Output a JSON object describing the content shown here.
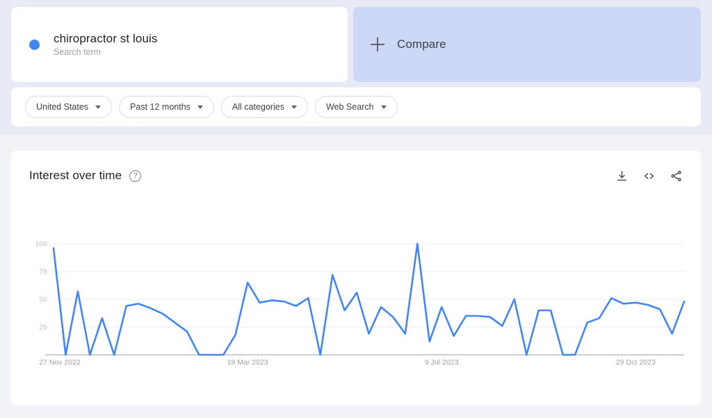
{
  "query": {
    "term": "chiropractor st louis",
    "type_label": "Search term",
    "dot_color": "#4285f4"
  },
  "compare": {
    "label": "Compare",
    "icon": "plus-icon",
    "background": "#ccd8f5"
  },
  "filters": [
    {
      "name": "location",
      "label": "United States"
    },
    {
      "name": "time-range",
      "label": "Past 12 months"
    },
    {
      "name": "category",
      "label": "All categories"
    },
    {
      "name": "search-type",
      "label": "Web Search"
    }
  ],
  "chart_card": {
    "title": "Interest over time",
    "help_glyph": "?",
    "actions": [
      {
        "name": "download-icon",
        "label": "Download CSV"
      },
      {
        "name": "embed-icon",
        "label": "Embed"
      },
      {
        "name": "share-icon",
        "label": "Share"
      }
    ]
  },
  "chart_data": {
    "type": "line",
    "title": "Interest over time",
    "xlabel": "",
    "ylabel": "",
    "ylim": [
      0,
      100
    ],
    "yticks": [
      100,
      75,
      50,
      25
    ],
    "grid": true,
    "legend": "none",
    "line_color": "#4285f4",
    "x_tick_labels": [
      "27 Nov 2022",
      "19 Mar 2023",
      "9 Jul 2023",
      "29 Oct 2023"
    ],
    "x_tick_indices": [
      0,
      16,
      32,
      48
    ],
    "series": [
      {
        "name": "chiropractor st louis",
        "color": "#4285f4",
        "values": [
          96,
          0,
          57,
          0,
          33,
          0,
          44,
          46,
          42,
          37,
          29,
          21,
          0,
          0,
          0,
          18,
          65,
          47,
          49,
          48,
          44,
          51,
          0,
          72,
          40,
          56,
          19,
          43,
          34,
          19,
          100,
          12,
          43,
          17,
          35,
          35,
          34,
          26,
          50,
          0,
          40,
          40,
          0,
          0,
          29,
          33,
          51,
          46,
          47,
          45,
          41,
          19,
          48
        ]
      }
    ]
  }
}
